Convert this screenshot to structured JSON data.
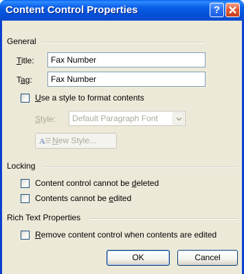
{
  "window": {
    "title": "Content Control Properties",
    "help_glyph": "?"
  },
  "general": {
    "label": "General",
    "title_label_pre": "",
    "title_label_ul": "T",
    "title_label_post": "itle:",
    "title_value": "Fax Number",
    "tag_label_pre": "T",
    "tag_label_ul": "a",
    "tag_label_post": "g:",
    "tag_value": "Fax Number",
    "use_style_pre": "",
    "use_style_ul": "U",
    "use_style_post": "se a style to format contents",
    "use_style_checked": false,
    "style_label_pre": "",
    "style_label_ul": "S",
    "style_label_post": "tyle:",
    "style_value": "Default Paragraph Font",
    "new_style_pre": "",
    "new_style_ul": "N",
    "new_style_post": "ew Style..."
  },
  "locking": {
    "label": "Locking",
    "cannot_delete_pre": "Content control cannot be ",
    "cannot_delete_ul": "d",
    "cannot_delete_post": "eleted",
    "cannot_delete_checked": false,
    "cannot_edit_pre": "Contents cannot be ",
    "cannot_edit_ul": "e",
    "cannot_edit_post": "dited",
    "cannot_edit_checked": false
  },
  "rich_text": {
    "label": "Rich Text Properties",
    "remove_pre": "",
    "remove_ul": "R",
    "remove_post": "emove content control when contents are edited",
    "remove_checked": false
  },
  "buttons": {
    "ok": "OK",
    "cancel": "Cancel"
  },
  "colors": {
    "titlebar_blue": "#0a5fe8",
    "dialog_face": "#ece9d8",
    "close_red": "#e35a36",
    "disabled_text": "#aca899"
  }
}
